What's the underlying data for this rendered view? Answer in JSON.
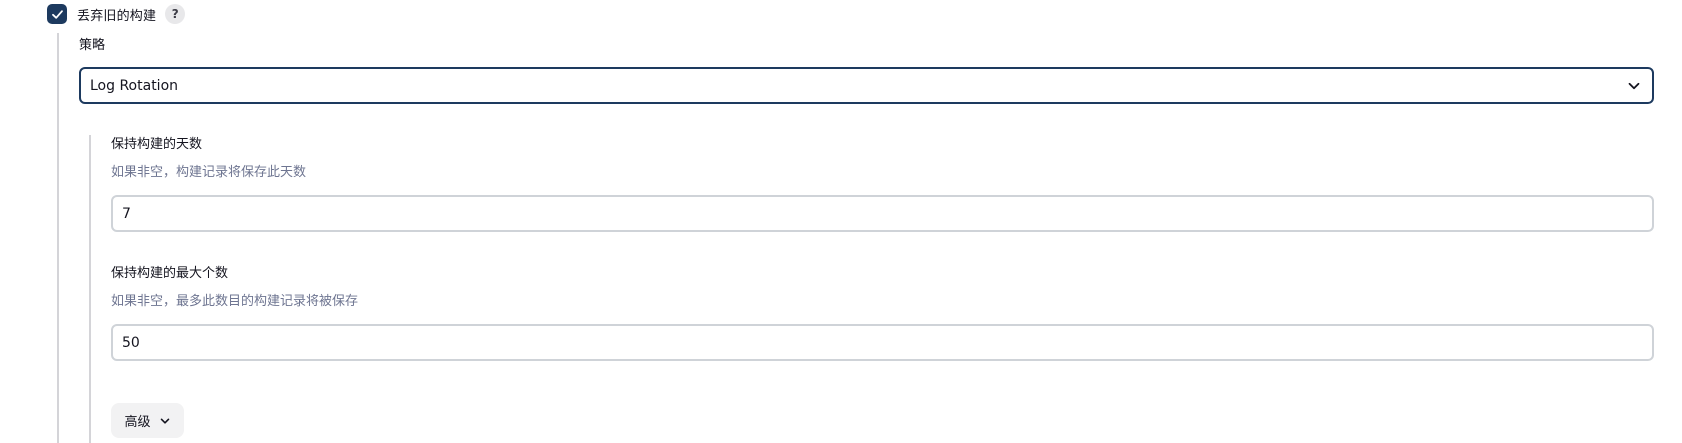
{
  "discard_old_builds": {
    "checkbox_label": "丢弃旧的构建",
    "checked": true,
    "help_label": "?"
  },
  "strategy": {
    "label": "策略",
    "selected": "Log Rotation"
  },
  "days_to_keep": {
    "label": "保持构建的天数",
    "description": "如果非空，构建记录将保存此天数",
    "value": "7"
  },
  "max_builds": {
    "label": "保持构建的最大个数",
    "description": "如果非空，最多此数目的构建记录将被保存",
    "value": "50"
  },
  "advanced": {
    "label": "高级"
  },
  "colors": {
    "accent": "#1d3a5f",
    "muted_text": "#6e7591",
    "input_border": "#cfd3d8"
  }
}
